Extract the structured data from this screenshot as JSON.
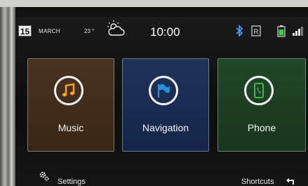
{
  "status": {
    "day": "15",
    "month": "MARCH",
    "temperature": "23 °",
    "weather_icon": "partly-cloudy-icon",
    "time": "10:00",
    "icons": [
      "bluetooth-icon",
      "r-icon",
      "battery-icon",
      "signal-icon"
    ]
  },
  "tiles": [
    {
      "label": "Music",
      "icon": "music-note-icon",
      "accent": "#f5a623"
    },
    {
      "label": "Navigation",
      "icon": "flag-icon",
      "accent": "#2a8fd6"
    },
    {
      "label": "Phone",
      "icon": "phone-icon",
      "accent": "#3dbb4a"
    }
  ],
  "bottom": {
    "settings_label": "Settings",
    "shortcuts_label": "Shortcuts"
  },
  "colors": {
    "music_tile": "#4a3220",
    "navigation_tile": "#1f3358",
    "phone_tile": "#224628"
  }
}
